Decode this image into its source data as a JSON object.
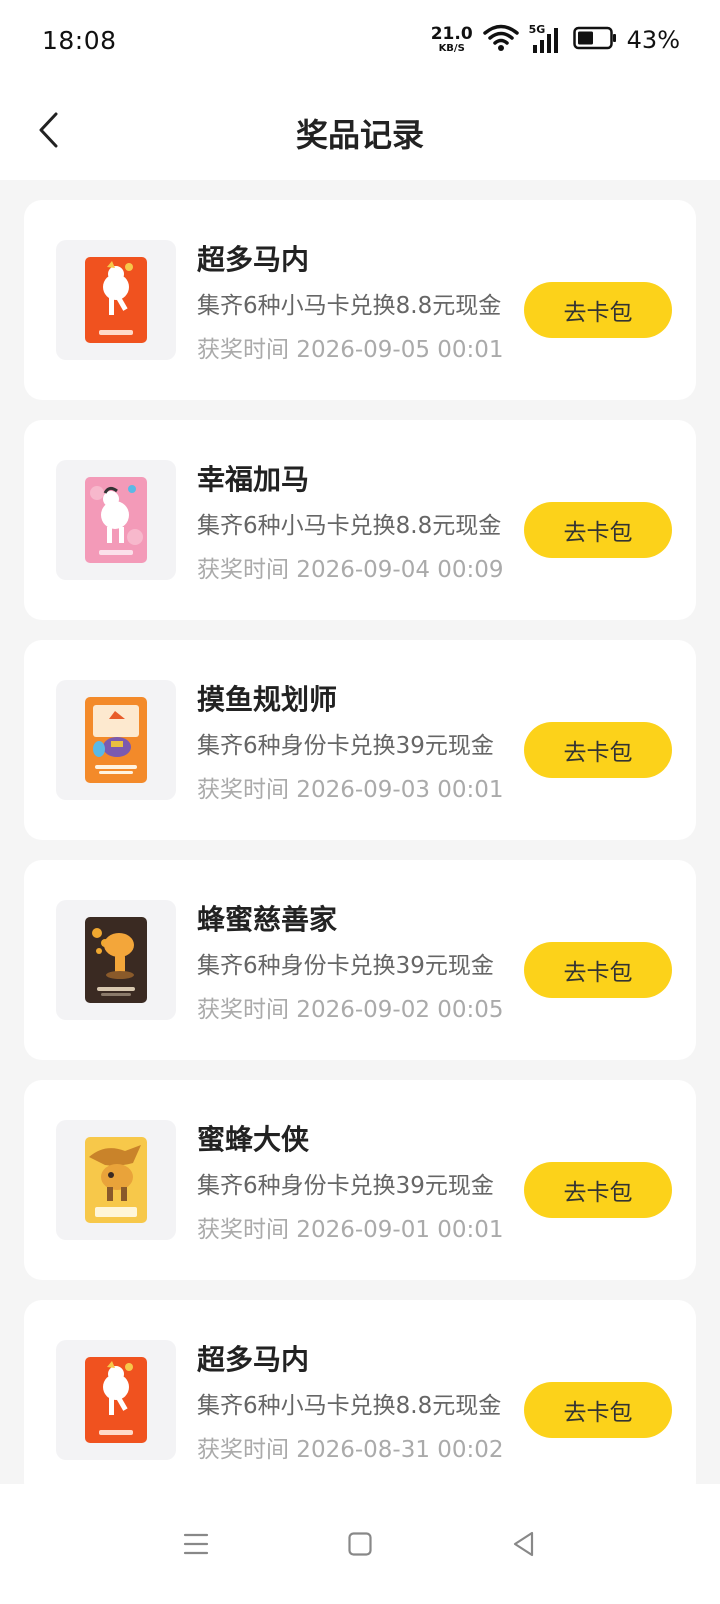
{
  "status_bar": {
    "time": "18:08",
    "net_speed": "21.0",
    "net_unit": "KB/S",
    "signal": "5G",
    "battery": "43%"
  },
  "header": {
    "title": "奖品记录",
    "back_icon": "chevron-left-icon"
  },
  "records": [
    {
      "title": "超多马内",
      "desc": "集齐6种小马卡兑换8.8元现金",
      "time": "获奖时间 2026-09-05 00:01",
      "button": "去卡包",
      "card_color": "#f0521f",
      "card_theme": "red-horse"
    },
    {
      "title": "幸福加马",
      "desc": "集齐6种小马卡兑换8.8元现金",
      "time": "获奖时间 2026-09-04 00:09",
      "button": "去卡包",
      "card_color": "#f39ab8",
      "card_theme": "pink-horse"
    },
    {
      "title": "摸鱼规划师",
      "desc": "集齐6种身份卡兑换39元现金",
      "time": "获奖时间 2026-09-03 00:01",
      "button": "去卡包",
      "card_color": "#f38a2a",
      "card_theme": "orange-fish"
    },
    {
      "title": "蜂蜜慈善家",
      "desc": "集齐6种身份卡兑换39元现金",
      "time": "获奖时间 2026-09-02 00:05",
      "button": "去卡包",
      "card_color": "#3a2a22",
      "card_theme": "dark-bee"
    },
    {
      "title": "蜜蜂大侠",
      "desc": "集齐6种身份卡兑换39元现金",
      "time": "获奖时间 2026-09-01 00:01",
      "button": "去卡包",
      "card_color": "#f7c84a",
      "card_theme": "yellow-bee"
    },
    {
      "title": "超多马内",
      "desc": "集齐6种小马卡兑换8.8元现金",
      "time": "获奖时间 2026-08-31 00:02",
      "button": "去卡包",
      "card_color": "#f0521f",
      "card_theme": "red-horse"
    }
  ],
  "nav_bar": {
    "menu_icon": "menu-icon",
    "home_icon": "square-home-icon",
    "back_icon": "triangle-back-icon"
  },
  "colors": {
    "accent_button": "#fcd21a",
    "page_bg": "#f5f5f5",
    "card_bg": "#ffffff"
  }
}
